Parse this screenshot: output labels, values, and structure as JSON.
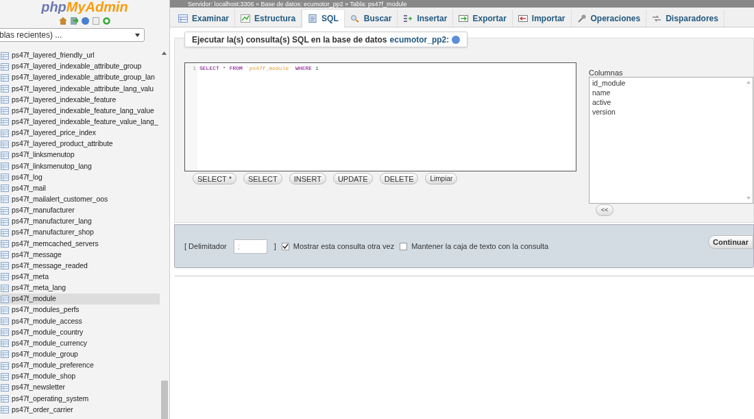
{
  "breadcrumb": "Servidor: localhost:3306 » Base de datos: ecumotor_pp2 » Tabla: ps47f_module",
  "sidebar": {
    "logo": {
      "left": "php",
      "right": "MyAdmin"
    },
    "recent": "blas recientes) ...",
    "tables": [
      {
        "name": "ps47f_layered_friendly_url",
        "selected": false
      },
      {
        "name": "ps47f_layered_indexable_attribute_group",
        "selected": false
      },
      {
        "name": "ps47f_layered_indexable_attribute_group_lan",
        "selected": false
      },
      {
        "name": "ps47f_layered_indexable_attribute_lang_valu",
        "selected": false
      },
      {
        "name": "ps47f_layered_indexable_feature",
        "selected": false
      },
      {
        "name": "ps47f_layered_indexable_feature_lang_value",
        "selected": false
      },
      {
        "name": "ps47f_layered_indexable_feature_value_lang_",
        "selected": false
      },
      {
        "name": "ps47f_layered_price_index",
        "selected": false
      },
      {
        "name": "ps47f_layered_product_attribute",
        "selected": false
      },
      {
        "name": "ps47f_linksmenutop",
        "selected": false
      },
      {
        "name": "ps47f_linksmenutop_lang",
        "selected": false
      },
      {
        "name": "ps47f_log",
        "selected": false
      },
      {
        "name": "ps47f_mail",
        "selected": false
      },
      {
        "name": "ps47f_mailalert_customer_oos",
        "selected": false
      },
      {
        "name": "ps47f_manufacturer",
        "selected": false
      },
      {
        "name": "ps47f_manufacturer_lang",
        "selected": false
      },
      {
        "name": "ps47f_manufacturer_shop",
        "selected": false
      },
      {
        "name": "ps47f_memcached_servers",
        "selected": false
      },
      {
        "name": "ps47f_message",
        "selected": false
      },
      {
        "name": "ps47f_message_readed",
        "selected": false
      },
      {
        "name": "ps47f_meta",
        "selected": false
      },
      {
        "name": "ps47f_meta_lang",
        "selected": false
      },
      {
        "name": "ps47f_module",
        "selected": true
      },
      {
        "name": "ps47f_modules_perfs",
        "selected": false
      },
      {
        "name": "ps47f_module_access",
        "selected": false
      },
      {
        "name": "ps47f_module_country",
        "selected": false
      },
      {
        "name": "ps47f_module_currency",
        "selected": false
      },
      {
        "name": "ps47f_module_group",
        "selected": false
      },
      {
        "name": "ps47f_module_preference",
        "selected": false
      },
      {
        "name": "ps47f_module_shop",
        "selected": false
      },
      {
        "name": "ps47f_newsletter",
        "selected": false
      },
      {
        "name": "ps47f_operating_system",
        "selected": false
      },
      {
        "name": "ps47f_order_carrier",
        "selected": false
      }
    ]
  },
  "tabs": [
    {
      "label": "Examinar",
      "kind": "browse",
      "selected": false
    },
    {
      "label": "Estructura",
      "kind": "structure",
      "selected": false
    },
    {
      "label": "SQL",
      "kind": "sql",
      "selected": true
    },
    {
      "label": "Buscar",
      "kind": "search",
      "selected": false
    },
    {
      "label": "Insertar",
      "kind": "insert",
      "selected": false
    },
    {
      "label": "Exportar",
      "kind": "export",
      "selected": false
    },
    {
      "label": "Importar",
      "kind": "import",
      "selected": false
    },
    {
      "label": "Operaciones",
      "kind": "operations",
      "selected": false
    },
    {
      "label": "Disparadores",
      "kind": "triggers",
      "selected": false
    }
  ],
  "query_panel": {
    "legend": "Ejecutar la(s) consulta(s) SQL en la base de datos",
    "database": "ecumotor_pp2:",
    "editor": {
      "line_number": "1",
      "tokens": [
        {
          "text": "SELECT",
          "kind": "keyword"
        },
        {
          "text": "*",
          "kind": "operator"
        },
        {
          "text": "FROM",
          "kind": "keyword"
        },
        {
          "text": "`ps47f_module`",
          "kind": "identifier"
        },
        {
          "text": "WHERE",
          "kind": "keyword"
        },
        {
          "text": "1",
          "kind": "number"
        }
      ]
    },
    "buttons": [
      "SELECT *",
      "SELECT",
      "INSERT",
      "UPDATE",
      "DELETE",
      "Limpiar"
    ],
    "columns_label": "Columnas",
    "columns": [
      "id_module",
      "name",
      "active",
      "version"
    ],
    "insert_button": "<<"
  },
  "options": {
    "delimiter_open": "[ Delimitador",
    "delimiter_value": ";",
    "delimiter_close": "]",
    "checkboxes": [
      {
        "label": "Mostrar esta consulta otra vez",
        "checked": true
      },
      {
        "label": "Mantener la caja de texto con la consulta",
        "checked": false
      }
    ],
    "submit": "Continuar"
  }
}
